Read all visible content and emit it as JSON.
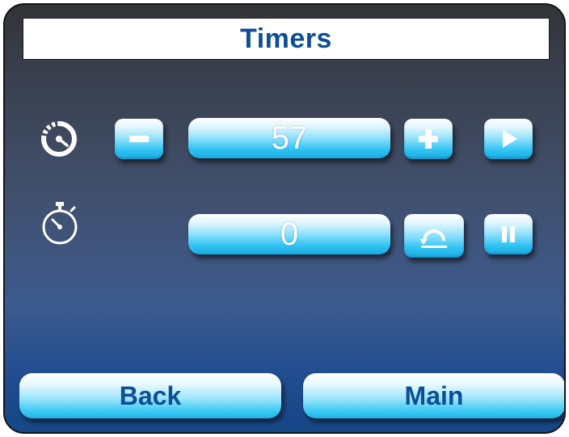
{
  "title": "Timers",
  "timer_row": {
    "icon": "timer-icon",
    "decrement_icon": "minus-icon",
    "value": "57",
    "increment_icon": "plus-icon",
    "start_icon": "play-icon"
  },
  "stopwatch_row": {
    "icon": "stopwatch-icon",
    "value": "0",
    "reset_icon": "reset-icon",
    "pause_icon": "pause-icon"
  },
  "nav": {
    "back_label": "Back",
    "main_label": "Main"
  },
  "colors": {
    "title_text": "#0d4e95",
    "button_light": "#dff6ff",
    "button_dark": "#1ba9e1",
    "panel_top": "#333438",
    "panel_bottom": "#164786"
  }
}
